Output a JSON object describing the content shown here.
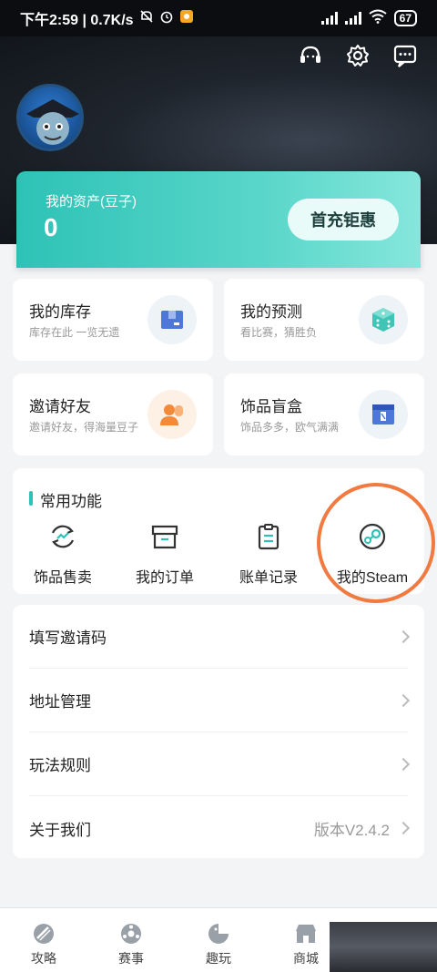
{
  "status_bar": {
    "time_text": "下午2:59 | 0.7K/s",
    "battery": "67"
  },
  "hero": {
    "icons": [
      "headset-icon",
      "gear-icon",
      "message-icon"
    ]
  },
  "asset": {
    "label": "我的资产(豆子)",
    "value": "0",
    "button": "首充钜惠"
  },
  "features": [
    {
      "title": "我的库存",
      "subtitle": "库存在此 一览无遗",
      "icon": "inventory-box-icon"
    },
    {
      "title": "我的预测",
      "subtitle": "看比赛，猜胜负",
      "icon": "dice-icon"
    },
    {
      "title": "邀请好友",
      "subtitle": "邀请好友，得海量豆子",
      "icon": "friends-icon"
    },
    {
      "title": "饰品盲盒",
      "subtitle": "饰品多多，欧气满满",
      "icon": "blind-box-icon"
    }
  ],
  "common": {
    "title": "常用功能",
    "items": [
      {
        "label": "饰品售卖",
        "icon": "sell-icon"
      },
      {
        "label": "我的订单",
        "icon": "order-icon"
      },
      {
        "label": "账单记录",
        "icon": "bill-icon"
      },
      {
        "label": "我的Steam",
        "icon": "steam-icon"
      }
    ]
  },
  "menu": [
    {
      "label": "填写邀请码",
      "value": ""
    },
    {
      "label": "地址管理",
      "value": ""
    },
    {
      "label": "玩法规则",
      "value": ""
    },
    {
      "label": "关于我们",
      "value": "版本V2.4.2"
    }
  ],
  "bottom_nav": [
    {
      "label": "攻略",
      "icon": "guide-icon"
    },
    {
      "label": "赛事",
      "icon": "football-icon"
    },
    {
      "label": "趣玩",
      "icon": "game-icon"
    },
    {
      "label": "商城",
      "icon": "store-icon"
    }
  ],
  "colors": {
    "accent": "#2ec2b6",
    "annotation": "#f07a40"
  }
}
